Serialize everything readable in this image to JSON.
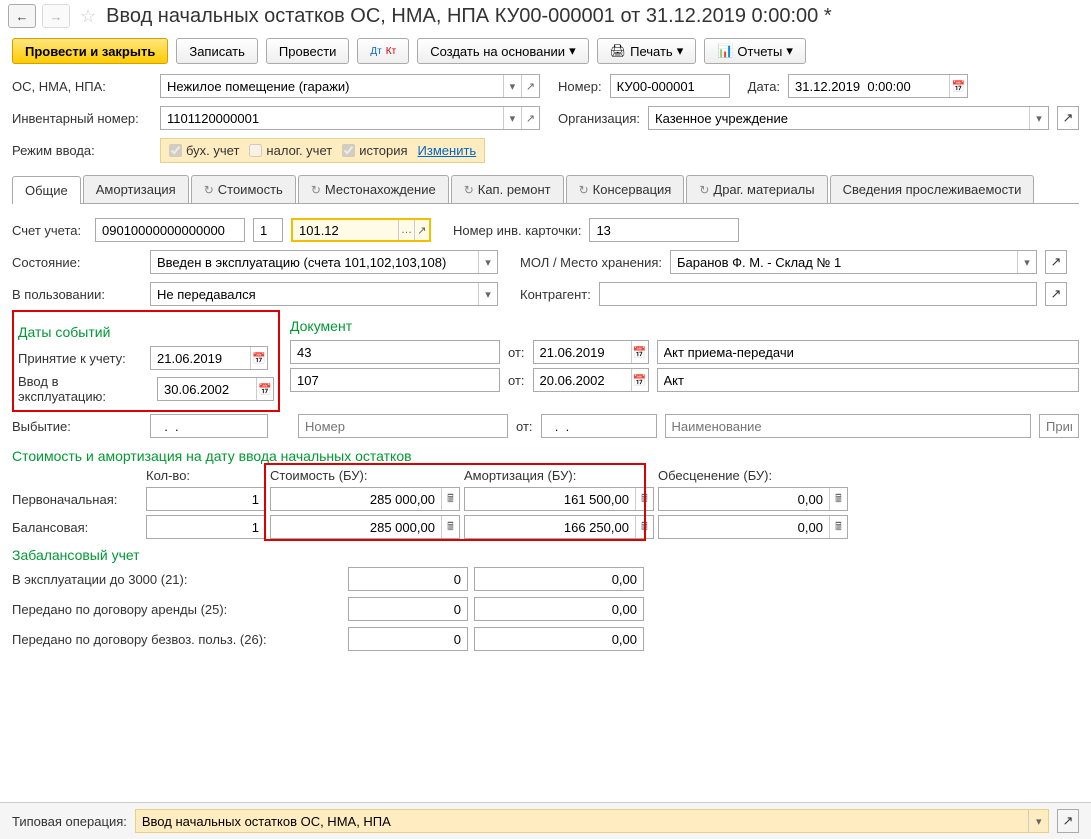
{
  "header": {
    "title": "Ввод начальных остатков ОС, НМА, НПА КУ00-000001 от 31.12.2019 0:00:00 *"
  },
  "toolbar": {
    "post_close": "Провести и закрыть",
    "save": "Записать",
    "post": "Провести",
    "create_based": "Создать на основании",
    "print": "Печать",
    "reports": "Отчеты"
  },
  "top": {
    "os_label": "ОС, НМА, НПА:",
    "os_value": "Нежилое помещение (гаражи)",
    "number_label": "Номер:",
    "number_value": "КУ00-000001",
    "date_label": "Дата:",
    "date_value": "31.12.2019  0:00:00",
    "inv_label": "Инвентарный номер:",
    "inv_value": "1101120000001",
    "org_label": "Организация:",
    "org_value": "Казенное учреждение",
    "mode_label": "Режим ввода:",
    "mode_buh": "бух. учет",
    "mode_nalog": "налог. учет",
    "mode_hist": "история",
    "mode_change": "Изменить"
  },
  "tabs": {
    "general": "Общие",
    "amort": "Амортизация",
    "cost": "Стоимость",
    "location": "Местонахождение",
    "kap": "Кап. ремонт",
    "cons": "Консервация",
    "drag": "Драг. материалы",
    "trace": "Сведения прослеживаемости"
  },
  "general": {
    "account_label": "Счет учета:",
    "account_value": "09010000000000000",
    "account_sub": "1",
    "account_code": "101.12",
    "card_label": "Номер инв. карточки:",
    "card_value": "13",
    "state_label": "Состояние:",
    "state_value": "Введен в эксплуатацию (счета 101,102,103,108)",
    "mol_label": "МОЛ / Место хранения:",
    "mol_value": "Баранов Ф. М. - Склад № 1",
    "inuse_label": "В пользовании:",
    "inuse_value": "Не передавался",
    "contr_label": "Контрагент:",
    "contr_value": ""
  },
  "dates": {
    "section": "Даты событий",
    "doc_section": "Документ",
    "accept_label": "Принятие к учету:",
    "accept_date": "21.06.2019",
    "expl_label": "Ввод в эксплуатацию:",
    "expl_date": "30.06.2002",
    "disposal_label": "Выбытие:",
    "disposal_date": "  .  .    ",
    "doc1_num": "43",
    "doc1_from": "от:",
    "doc1_date": "21.06.2019",
    "doc1_name": "Акт приема-передачи",
    "doc2_num": "107",
    "doc2_date": "20.06.2002",
    "doc2_name": "Акт",
    "doc3_num_ph": "Номер",
    "doc3_date": "  .  .    ",
    "doc3_name_ph": "Наименование",
    "doc3_order_ph": "Прик"
  },
  "cost": {
    "section": "Стоимость и амортизация на дату ввода начальных остатков",
    "qty_head": "Кол-во:",
    "cost_head": "Стоимость (БУ):",
    "amort_head": "Амортизация (БУ):",
    "impair_head": "Обесценение (БУ):",
    "initial_label": "Первоначальная:",
    "balance_label": "Балансовая:",
    "qty1": "1",
    "qty2": "1",
    "cost1": "285 000,00",
    "cost2": "285 000,00",
    "amort1": "161 500,00",
    "amort2": "166 250,00",
    "impair1": "0,00",
    "impair2": "0,00"
  },
  "offbal": {
    "section": "Забалансовый учет",
    "row1_label": "В эксплуатации до 3000 (21):",
    "row2_label": "Передано по договору аренды (25):",
    "row3_label": "Передано по договору безвоз. польз. (26):",
    "zero_qty": "0",
    "zero_val": "0,00"
  },
  "footer": {
    "label": "Типовая операция:",
    "value": "Ввод начальных остатков ОС, НМА, НПА"
  }
}
